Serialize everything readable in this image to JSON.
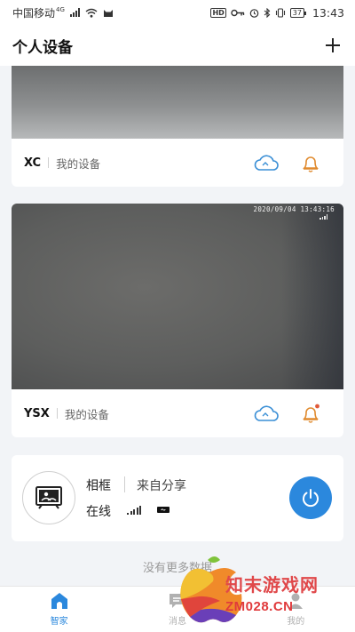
{
  "status_bar": {
    "carrier": "中国移动",
    "network": "4G",
    "battery": "37",
    "time": "13:43"
  },
  "header": {
    "title": "个人设备",
    "add_icon": "plus-icon"
  },
  "devices": [
    {
      "name": "XC",
      "owner": "我的设备",
      "cloud_icon": "cloud-icon",
      "alarm_icon": "bell-icon"
    },
    {
      "name": "YSX",
      "owner": "我的设备",
      "timestamp": "2020/09/04 13:43:16",
      "cloud_icon": "cloud-icon",
      "alarm_icon": "bell-icon"
    }
  ],
  "photo_frame": {
    "name": "相框",
    "source": "来自分享",
    "status": "在线",
    "power_icon": "power-icon"
  },
  "footer_note": "没有更多数据",
  "tabs": [
    {
      "label": "智家",
      "icon": "home-icon",
      "active": true
    },
    {
      "label": "消息",
      "icon": "message-icon",
      "active": false
    },
    {
      "label": "我的",
      "icon": "profile-icon",
      "active": false
    }
  ],
  "watermark": {
    "title": "知末游戏网",
    "url": "ZM028.CN"
  },
  "colors": {
    "accent": "#2b88dd",
    "cloud": "#3a8fd6",
    "bell": "#e08a2e",
    "bell_dot": "#e05a3a",
    "watermark_red": "#e0484a"
  }
}
